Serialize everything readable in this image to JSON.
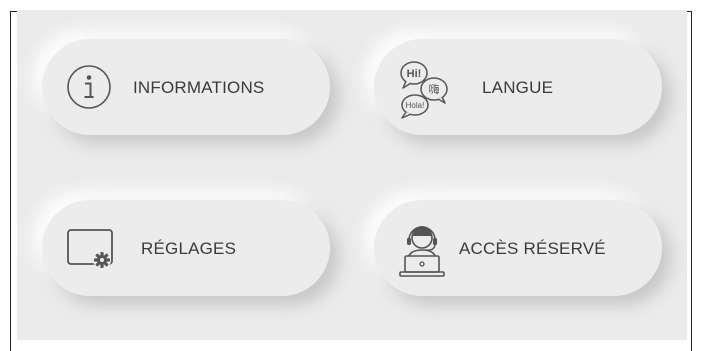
{
  "tiles": {
    "informations": {
      "label": "INFORMATIONS",
      "icon": "info-icon"
    },
    "langue": {
      "label": "LANGUE",
      "icon": "speech-bubbles-icon",
      "bubbles": {
        "hi": "Hi!",
        "chinese": "嗨",
        "hola": "Hola!"
      }
    },
    "reglages": {
      "label": "RÉGLAGES",
      "icon": "screen-gear-icon"
    },
    "acces": {
      "label": "ACCÈS RÉSERVÉ",
      "icon": "support-agent-icon"
    }
  },
  "colors": {
    "background": "#ebebeb",
    "tile": "#ececec",
    "text": "#3a3a3a",
    "icon": "#555555"
  }
}
